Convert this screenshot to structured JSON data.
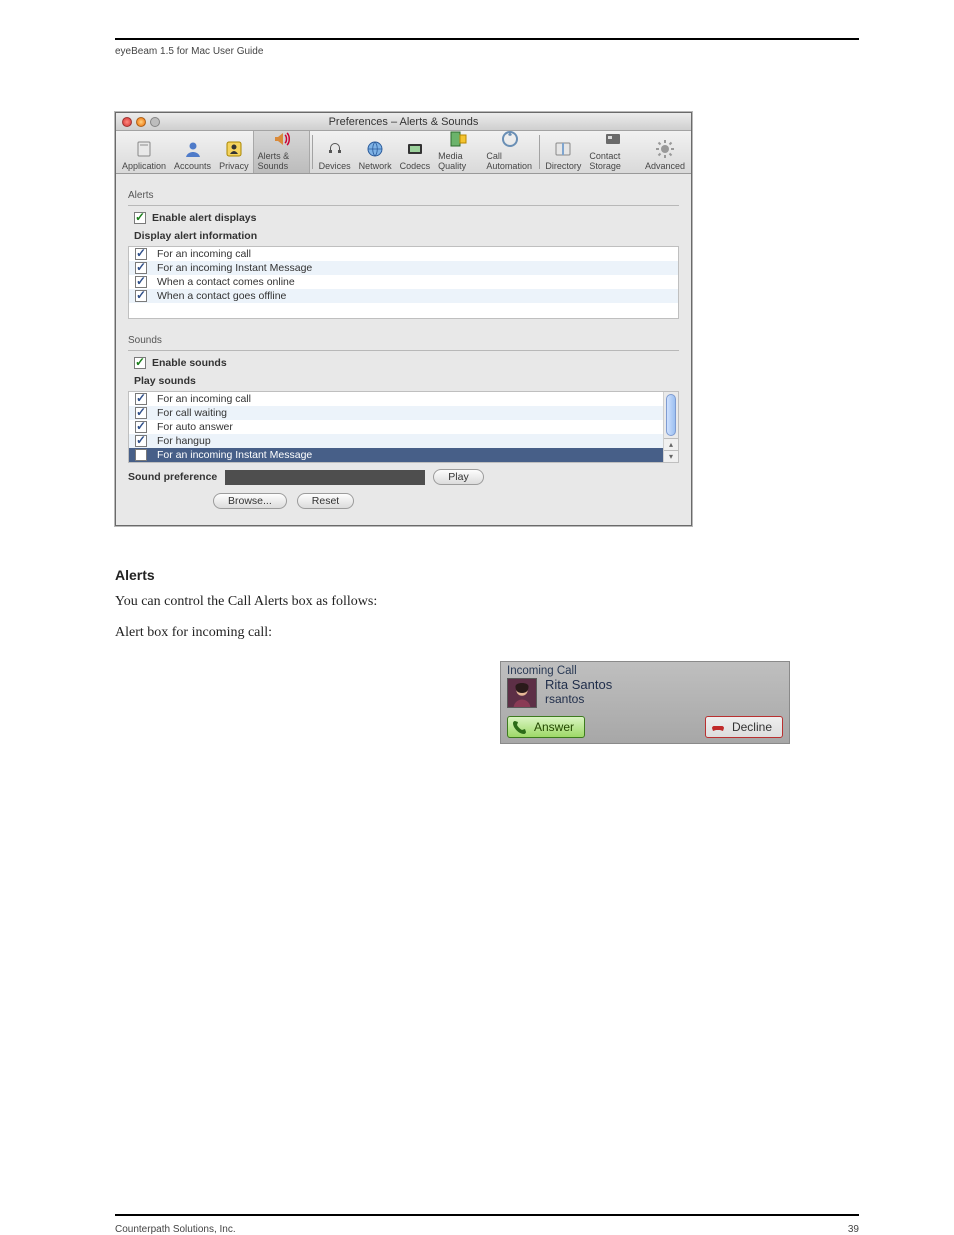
{
  "page": {
    "header_left": "eyeBeam 1.5 for Mac User Guide",
    "footer_left": "Counterpath Solutions, Inc.",
    "footer_right": "39"
  },
  "prefs": {
    "title": "Preferences – Alerts & Sounds",
    "tabs": [
      {
        "label": "Application",
        "icon": "app"
      },
      {
        "label": "Accounts",
        "icon": "account"
      },
      {
        "label": "Privacy",
        "icon": "privacy"
      },
      {
        "label": "Alerts & Sounds",
        "icon": "alerts"
      },
      {
        "label": "Devices",
        "icon": "devices"
      },
      {
        "label": "Network",
        "icon": "network"
      },
      {
        "label": "Codecs",
        "icon": "codecs"
      },
      {
        "label": "Media Quality",
        "icon": "media"
      },
      {
        "label": "Call Automation",
        "icon": "automation"
      },
      {
        "label": "Directory",
        "icon": "directory"
      },
      {
        "label": "Contact Storage",
        "icon": "storage"
      },
      {
        "label": "Advanced",
        "icon": "advanced"
      }
    ],
    "alerts_group": "Alerts",
    "enable_alerts_label": "Enable alert displays",
    "display_alert_label": "Display alert information",
    "alert_items": [
      "For an incoming call",
      "For an incoming Instant Message",
      "When a contact comes online",
      "When a contact goes offline"
    ],
    "sounds_group": "Sounds",
    "enable_sounds_label": "Enable sounds",
    "play_sounds_label": "Play sounds",
    "sound_items": [
      "For an incoming call",
      "For call waiting",
      "For auto answer",
      "For hangup",
      "For an incoming Instant Message"
    ],
    "sound_pref_label": "Sound preference",
    "play_btn": "Play",
    "browse_btn": "Browse...",
    "reset_btn": "Reset"
  },
  "section": {
    "heading": "Alerts",
    "p1": "You can control the Call Alerts box as follows:",
    "p2": "Alert box for incoming call:"
  },
  "alert": {
    "title": "Incoming Call",
    "name": "Rita Santos",
    "user": "rsantos",
    "answer": "Answer",
    "decline": "Decline"
  }
}
